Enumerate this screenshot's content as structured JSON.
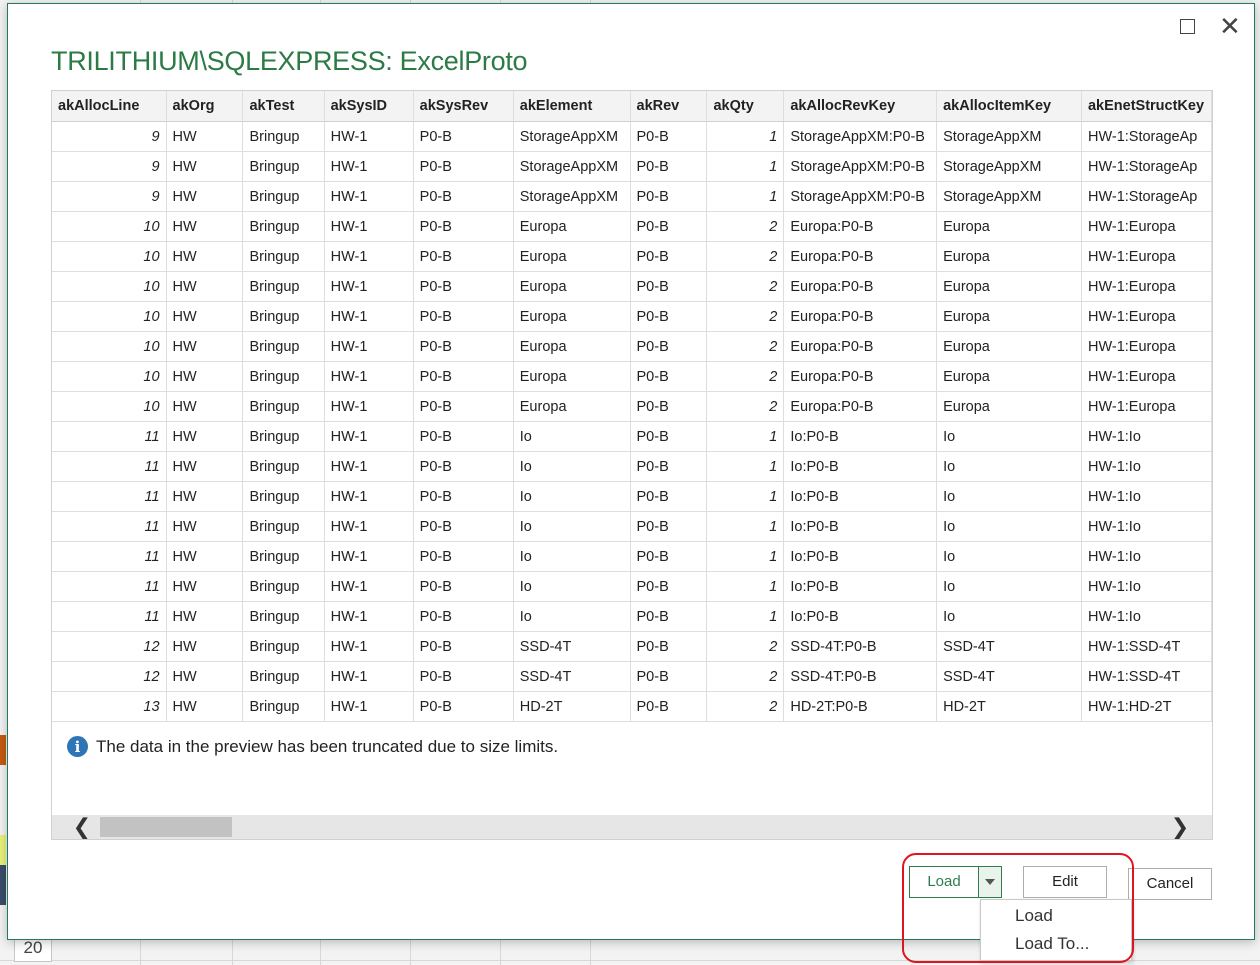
{
  "dialog": {
    "title": "TRILITHIUM\\SQLEXPRESS: ExcelProto",
    "info_message": "The data in the preview has been truncated due to size limits.",
    "buttons": {
      "load": "Load",
      "edit": "Edit",
      "cancel": "Cancel"
    },
    "load_menu": [
      "Load",
      "Load To..."
    ]
  },
  "sheet": {
    "row_number": "20"
  },
  "table": {
    "columns": [
      "akAllocLine",
      "akOrg",
      "akTest",
      "akSysID",
      "akSysRev",
      "akElement",
      "akRev",
      "akQty",
      "akAllocRevKey",
      "akAllocItemKey",
      "akEnetStructKey"
    ],
    "rows": [
      [
        "9",
        "HW",
        "Bringup",
        "HW-1",
        "P0-B",
        "StorageAppXM",
        "P0-B",
        "1",
        "StorageAppXM:P0-B",
        "StorageAppXM",
        "HW-1:StorageAp"
      ],
      [
        "9",
        "HW",
        "Bringup",
        "HW-1",
        "P0-B",
        "StorageAppXM",
        "P0-B",
        "1",
        "StorageAppXM:P0-B",
        "StorageAppXM",
        "HW-1:StorageAp"
      ],
      [
        "9",
        "HW",
        "Bringup",
        "HW-1",
        "P0-B",
        "StorageAppXM",
        "P0-B",
        "1",
        "StorageAppXM:P0-B",
        "StorageAppXM",
        "HW-1:StorageAp"
      ],
      [
        "10",
        "HW",
        "Bringup",
        "HW-1",
        "P0-B",
        "Europa",
        "P0-B",
        "2",
        "Europa:P0-B",
        "Europa",
        "HW-1:Europa"
      ],
      [
        "10",
        "HW",
        "Bringup",
        "HW-1",
        "P0-B",
        "Europa",
        "P0-B",
        "2",
        "Europa:P0-B",
        "Europa",
        "HW-1:Europa"
      ],
      [
        "10",
        "HW",
        "Bringup",
        "HW-1",
        "P0-B",
        "Europa",
        "P0-B",
        "2",
        "Europa:P0-B",
        "Europa",
        "HW-1:Europa"
      ],
      [
        "10",
        "HW",
        "Bringup",
        "HW-1",
        "P0-B",
        "Europa",
        "P0-B",
        "2",
        "Europa:P0-B",
        "Europa",
        "HW-1:Europa"
      ],
      [
        "10",
        "HW",
        "Bringup",
        "HW-1",
        "P0-B",
        "Europa",
        "P0-B",
        "2",
        "Europa:P0-B",
        "Europa",
        "HW-1:Europa"
      ],
      [
        "10",
        "HW",
        "Bringup",
        "HW-1",
        "P0-B",
        "Europa",
        "P0-B",
        "2",
        "Europa:P0-B",
        "Europa",
        "HW-1:Europa"
      ],
      [
        "10",
        "HW",
        "Bringup",
        "HW-1",
        "P0-B",
        "Europa",
        "P0-B",
        "2",
        "Europa:P0-B",
        "Europa",
        "HW-1:Europa"
      ],
      [
        "11",
        "HW",
        "Bringup",
        "HW-1",
        "P0-B",
        "Io",
        "P0-B",
        "1",
        "Io:P0-B",
        "Io",
        "HW-1:Io"
      ],
      [
        "11",
        "HW",
        "Bringup",
        "HW-1",
        "P0-B",
        "Io",
        "P0-B",
        "1",
        "Io:P0-B",
        "Io",
        "HW-1:Io"
      ],
      [
        "11",
        "HW",
        "Bringup",
        "HW-1",
        "P0-B",
        "Io",
        "P0-B",
        "1",
        "Io:P0-B",
        "Io",
        "HW-1:Io"
      ],
      [
        "11",
        "HW",
        "Bringup",
        "HW-1",
        "P0-B",
        "Io",
        "P0-B",
        "1",
        "Io:P0-B",
        "Io",
        "HW-1:Io"
      ],
      [
        "11",
        "HW",
        "Bringup",
        "HW-1",
        "P0-B",
        "Io",
        "P0-B",
        "1",
        "Io:P0-B",
        "Io",
        "HW-1:Io"
      ],
      [
        "11",
        "HW",
        "Bringup",
        "HW-1",
        "P0-B",
        "Io",
        "P0-B",
        "1",
        "Io:P0-B",
        "Io",
        "HW-1:Io"
      ],
      [
        "11",
        "HW",
        "Bringup",
        "HW-1",
        "P0-B",
        "Io",
        "P0-B",
        "1",
        "Io:P0-B",
        "Io",
        "HW-1:Io"
      ],
      [
        "12",
        "HW",
        "Bringup",
        "HW-1",
        "P0-B",
        "SSD-4T",
        "P0-B",
        "2",
        "SSD-4T:P0-B",
        "SSD-4T",
        "HW-1:SSD-4T"
      ],
      [
        "12",
        "HW",
        "Bringup",
        "HW-1",
        "P0-B",
        "SSD-4T",
        "P0-B",
        "2",
        "SSD-4T:P0-B",
        "SSD-4T",
        "HW-1:SSD-4T"
      ],
      [
        "13",
        "HW",
        "Bringup",
        "HW-1",
        "P0-B",
        "HD-2T",
        "P0-B",
        "2",
        "HD-2T:P0-B",
        "HD-2T",
        "HW-1:HD-2T"
      ]
    ]
  },
  "colors": {
    "title_green": "#2c7a45",
    "highlight_red": "#e0141e",
    "info_blue": "#2e75b6"
  }
}
